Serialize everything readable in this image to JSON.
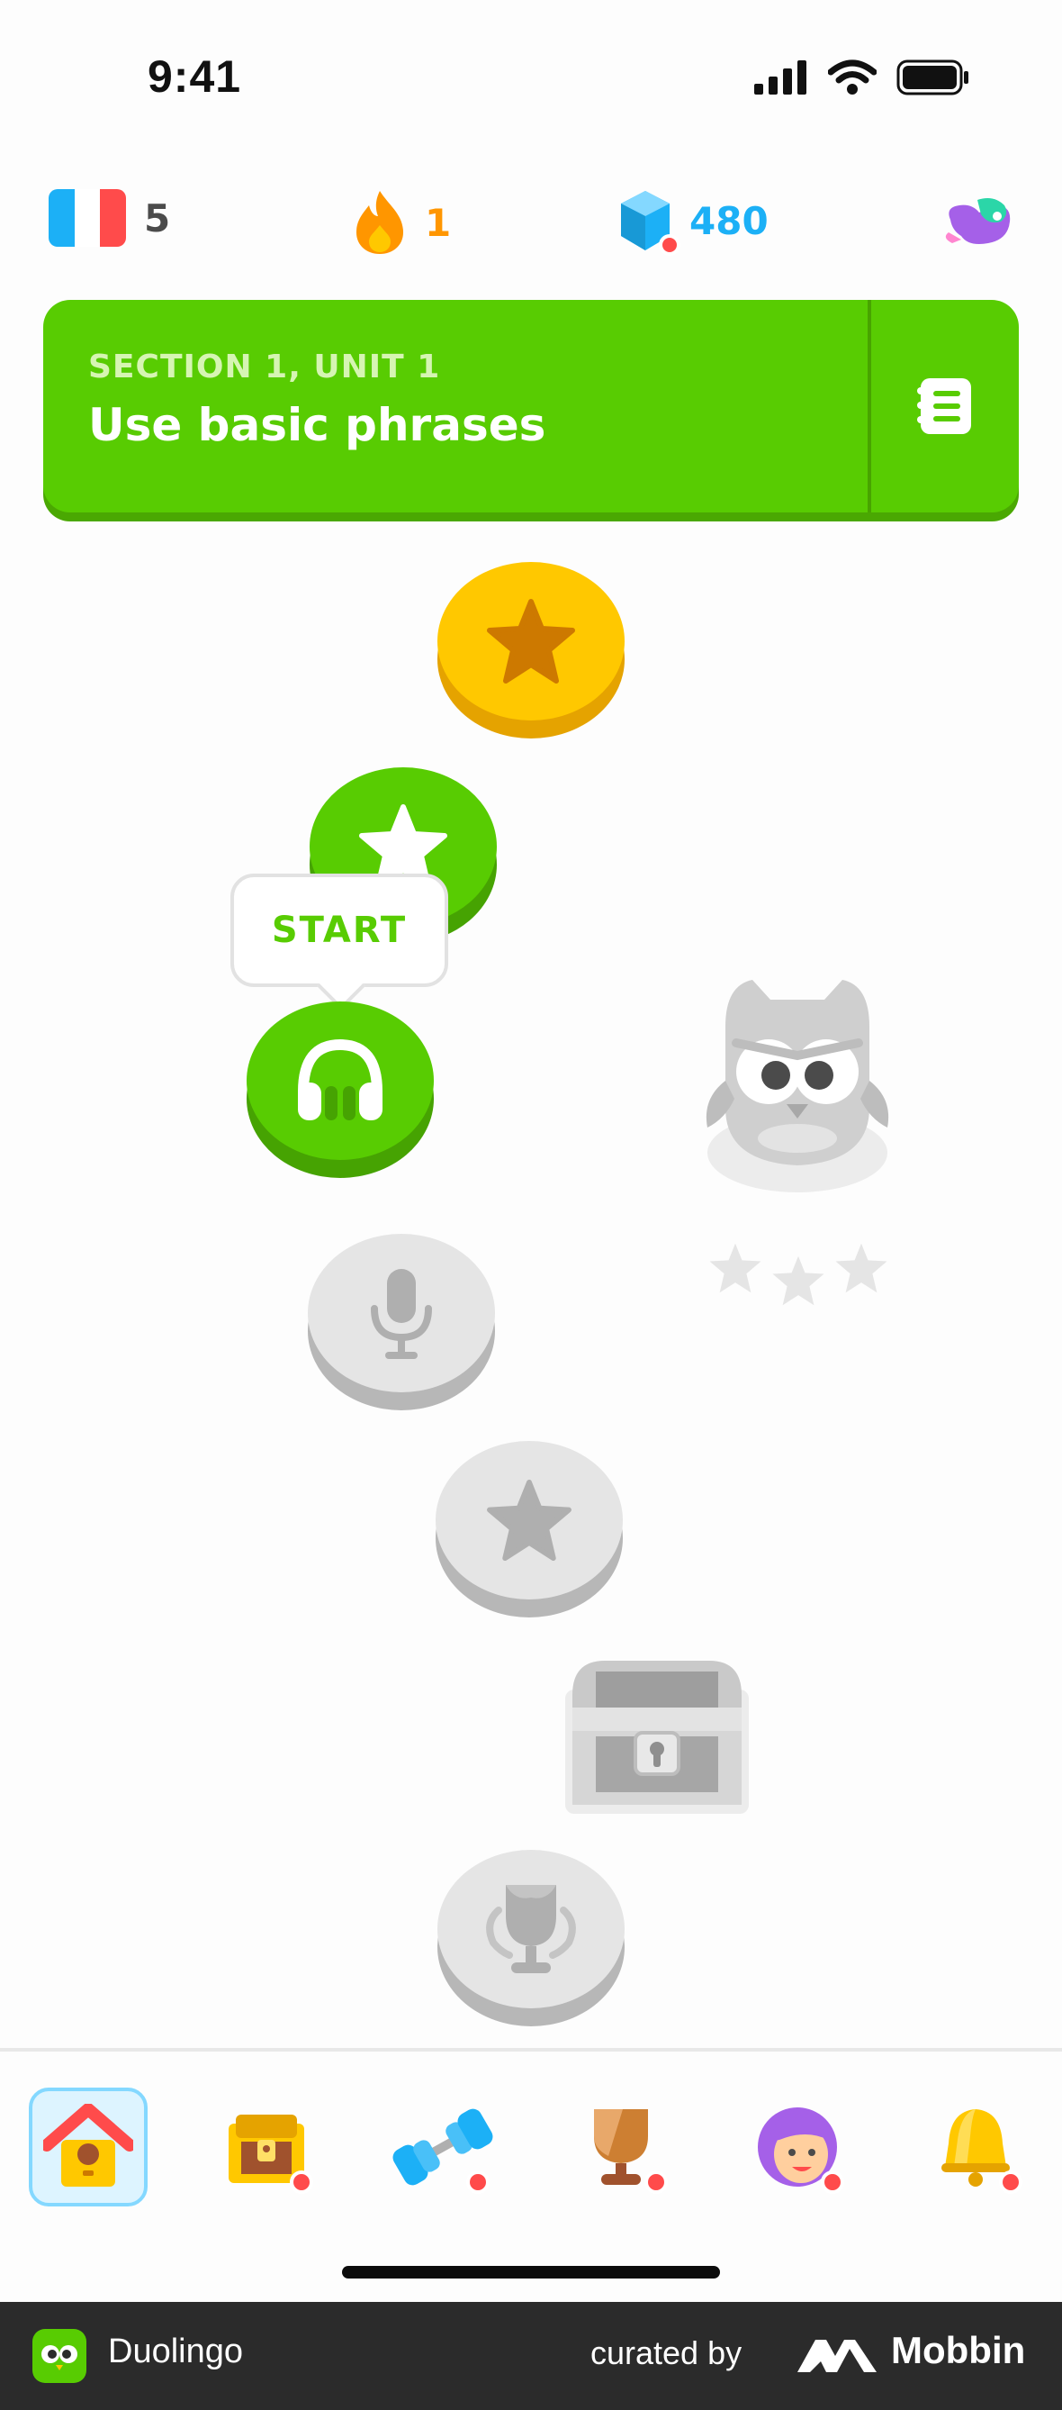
{
  "status_bar": {
    "time": "9:41"
  },
  "stats": {
    "course_flag": "flag-france-icon",
    "course_count": "5",
    "streak": "1",
    "gems": "480",
    "colors": {
      "streak": "#ff9600",
      "gems": "#1cb0f6",
      "count": "#4b4b4b"
    }
  },
  "unit": {
    "section": "SECTION 1, UNIT 1",
    "title": "Use basic phrases",
    "guide_icon": "guidebook-icon",
    "color": "#58cc02"
  },
  "path": {
    "start_label": "START",
    "nodes": [
      {
        "state": "completed",
        "icon": "star-icon"
      },
      {
        "state": "available",
        "icon": "star-icon"
      },
      {
        "state": "current",
        "icon": "headphones-icon"
      },
      {
        "state": "locked",
        "icon": "microphone-icon"
      },
      {
        "state": "locked",
        "icon": "star-icon"
      },
      {
        "state": "locked",
        "icon": "treasure-chest-icon"
      },
      {
        "state": "locked",
        "icon": "trophy-icon"
      }
    ],
    "character": "owl-icon",
    "character_stars": 3
  },
  "nav": {
    "items": [
      {
        "icon": "home-icon",
        "active": true
      },
      {
        "icon": "quests-chest-icon"
      },
      {
        "icon": "practice-dumbbell-icon"
      },
      {
        "icon": "leaderboard-trophy-icon"
      },
      {
        "icon": "profile-avatar-icon"
      },
      {
        "icon": "notifications-bell-icon"
      }
    ]
  },
  "footer": {
    "app_name": "Duolingo",
    "curated_by": "curated by",
    "brand": "Mobbin"
  }
}
